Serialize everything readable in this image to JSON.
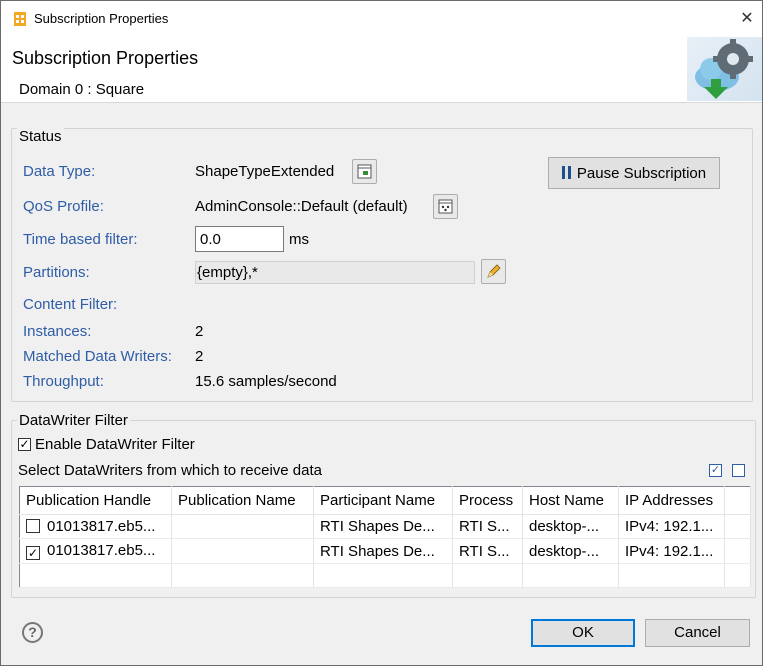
{
  "window": {
    "title": "Subscription Properties"
  },
  "header": {
    "title": "Subscription Properties",
    "subtitle": "Domain 0 : Square"
  },
  "status": {
    "group_title": "Status",
    "data_type_label": "Data Type:",
    "data_type_value": "ShapeTypeExtended",
    "qos_label": "QoS Profile:",
    "qos_value": "AdminConsole::Default (default)",
    "time_filter_label": "Time based filter:",
    "time_filter_value": "0.0",
    "time_filter_unit": "ms",
    "partitions_label": "Partitions:",
    "partitions_value": "{empty},*",
    "content_filter_label": "Content Filter:",
    "instances_label": "Instances:",
    "instances_value": "2",
    "matched_writers_label": "Matched Data Writers:",
    "matched_writers_value": "2",
    "throughput_label": "Throughput:",
    "throughput_value": "15.6 samples/second",
    "pause_button": "Pause Subscription"
  },
  "writer_filter": {
    "group_title": "DataWriter Filter",
    "enable_label": "Enable DataWriter Filter",
    "enable_checked": true,
    "select_label": "Select DataWriters from which to receive data",
    "columns": [
      "Publication Handle",
      "Publication Name",
      "Participant Name",
      "Process",
      "Host Name",
      "IP Addresses"
    ],
    "rows": [
      {
        "checked": false,
        "handle": "01013817.eb5...",
        "pub_name": "",
        "participant": "RTI Shapes De...",
        "process": "RTI S...",
        "host": "desktop-...",
        "ip": "IPv4: 192.1..."
      },
      {
        "checked": true,
        "handle": "01013817.eb5...",
        "pub_name": "",
        "participant": "RTI Shapes De...",
        "process": "RTI S...",
        "host": "desktop-...",
        "ip": "IPv4: 192.1..."
      }
    ]
  },
  "footer": {
    "ok": "OK",
    "cancel": "Cancel",
    "help_symbol": "?"
  },
  "colors": {
    "label_blue": "#2f5da6",
    "accent": "#0078d7"
  }
}
